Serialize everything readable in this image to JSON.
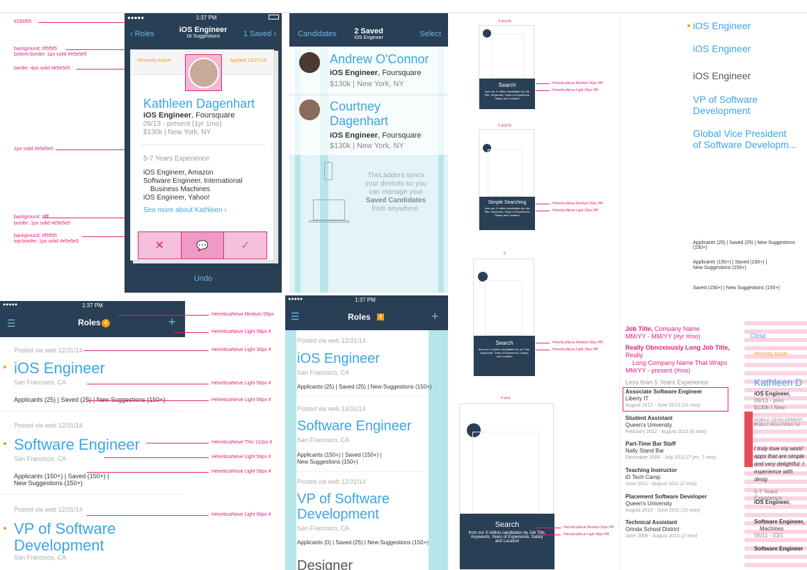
{
  "annotations_left": [
    "#283f55",
    "background: #f5f5f5",
    "bottom-border: 1px solid #e5e5e5",
    "border: 4px solid #e5e5e5",
    "1px solid #e5e5e5",
    "background: #fff",
    "border: 1px solid #e5e5e5",
    "background: #f5f5f5",
    "top-border: 1px solid #e5e5e5"
  ],
  "phone1": {
    "carrier": "●●●●●",
    "time": "1:37 PM",
    "back": "Roles",
    "title": "iOS Engineer",
    "subtitle": "16 Suggestions",
    "saved": "1 Saved",
    "recently_active": "Recently Active",
    "applied": "Applied 12/27/14",
    "name": "Kathleen Dagenhart",
    "role": "iOS Engineer",
    "company": "Foursquare",
    "dates": "09/13 - present (1yr 1mo)",
    "salary_loc": "$130k | New York, NY",
    "experience": "5-7 Years Experience",
    "jobs": [
      "iOS Engineer, Amazon",
      "Software Engineer, International",
      "Business Machines",
      "iOS Engineer, Yahoo!"
    ],
    "see_more": "See more about Kathleen ›",
    "undo": "Undo"
  },
  "phone2": {
    "back": "Candidates",
    "title": "2 Saved",
    "subtitle": "iOS Engineer",
    "select": "Select",
    "candidates": [
      {
        "name": "Andrew O'Connor",
        "role": "iOS Engineer",
        "company": "Foursquare",
        "meta": "$130k | New York, NY"
      },
      {
        "name": "Courtney Dagenhart",
        "role": "iOS Engineer",
        "company": "Foursquare",
        "meta": "$130k | New York, NY"
      }
    ],
    "sync_text_1": "TheLadders syncs",
    "sync_text_2": "your devices so you",
    "sync_text_3": "can manage your",
    "sync_bold": "Saved Candidates",
    "sync_text_4": "from anywhere."
  },
  "phone3": {
    "time": "1:37 PM",
    "title": "Roles",
    "badge": "4",
    "posted": "Posted via web 12/31/14",
    "items": [
      {
        "title": "iOS Engineer",
        "loc": "San Francisco, CA",
        "stats": "Applicants (25) | Saved (25) | New Suggestions (150+)"
      },
      {
        "title": "Software Engineer",
        "loc": "San Francisco, CA",
        "stats1": "Applicants (150+) | Saved (150+) |",
        "stats2": "New Suggestions (150+)"
      },
      {
        "title": "VP of Software",
        "title2": "Development",
        "loc": "San Francisco, CA"
      }
    ],
    "annotations": [
      "HelveticaNeue Medium 56px",
      "HelveticaNeue Light 56px #",
      "HelveticaNeue Light 36px #",
      "HelveticaNeue Light 56px #",
      "HelveticaNeue Light 56px #",
      "HelveticaNeue Thin 112px #",
      "HelveticaNeue Light 56px #",
      "HelveticaNeue Light 56px #",
      "HelveticaNeue Light 56px #"
    ]
  },
  "phone4": {
    "time": "1:37 PM",
    "title": "Roles",
    "badge": "4",
    "posted": "Posted via web 12/31/14",
    "items": [
      {
        "title": "iOS Engineer",
        "loc": "San Francisco, CA",
        "stats": "Applicants (25) | Saved (25) | New Suggestions (150+)"
      },
      {
        "title": "Software Engineer",
        "loc": "San Francisco, CA",
        "stats1": "Applicants (150+) | Saved (150+) |",
        "stats2": "New Suggestions (150+)"
      },
      {
        "title": "VP of Software",
        "title2": "Development",
        "loc": "San Francisco, CA",
        "stats": "Applicants (0) | Saved (25) | New Suggestions (150+)"
      },
      {
        "title": "Designer"
      }
    ]
  },
  "onboarding": {
    "labels": [
      "4 and 4s",
      "5 and 5s",
      "6",
      "6 plus"
    ],
    "titles": [
      "Search",
      "Simple Searching",
      "Search",
      "Search"
    ],
    "body": "from our X million candidates by Job Title, Keywords, Years of Experience, Salary and Location",
    "annotations": [
      "HelveticaNeue Medium 56px #fff",
      "HelveticaNeue Light 30px #fff",
      "HelveticaNeue Medium 56px #fff",
      "HelveticaNeue Light 30px #fff",
      "HelveticaNeue Medium 60px #fff",
      "HelveticaNeue Light 34px #fff",
      "HelveticaNeue Medium 90px #fff",
      "HelveticaNeue Light 48px #fff"
    ]
  },
  "specs": {
    "titles": [
      "iOS Engineer",
      "iOS Engineer",
      "iOS Engineer",
      "VP of Software",
      "Development",
      "Global Vice President",
      "of Software Developm..."
    ],
    "status": [
      "Applicants (25) | Saved (25) | New Suggestions (150+)",
      "Applicants (150+) | Saved (150+) |",
      "New Suggestions (150+)",
      "Saved (150+) | New Suggestions (150+)"
    ],
    "job_title": "Job Title,",
    "company_name": "Company Name",
    "dates_mm": "MM/YY - MM/YY (#yr #mo)",
    "long_title": "Really Obnoxiously Long Job Title,",
    "long_title_rest": "Really",
    "long_company": "Long Company Name That Wraps",
    "present": "MM/YY - present (#mo)",
    "less_than": "Less than 5 Years Experience",
    "history": [
      {
        "title": "Associate Software Engineer",
        "company": "Liberty IT",
        "dates": "August 2012 - June 2013",
        "dur": "(10 mos)"
      },
      {
        "title": "Student Assistant",
        "company": "Queen's University",
        "dates": "February 2012 - August 2012",
        "dur": "(6 mos)"
      },
      {
        "title": "Part-Time Bar Staff",
        "company": "Nally Stand Bar",
        "dates": "December 2004 - July 2012",
        "dur": "(7 yrs, 7 mos)"
      },
      {
        "title": "Teaching Instructor",
        "company": "iD Tech Camp",
        "dates": "June 2011 - August 2011",
        "dur": "(2 mos)"
      },
      {
        "title": "Placement Software Developer",
        "company": "Queen's University",
        "dates": "August 2010 - June 2011",
        "dur": "(10 mos)"
      },
      {
        "title": "Technical Assistant",
        "company": "Orinda School District",
        "dates": "June 2008 - August 2010",
        "dur": "(2 mos)"
      }
    ]
  },
  "phone5": {
    "close": "Close",
    "recently_active": "Recently Active",
    "name": "Kathleen D",
    "lines": [
      "iOS Engineer,",
      "09/13 - pres",
      "$130k | New"
    ],
    "skills": "MOBILE DEVELOPMENT, A",
    "skills2": "PUBLIC RELATIONS SA",
    "quote1": "I truly love my work!",
    "quote2": "apps that are simple",
    "quote3": "and very delightful. I",
    "quote4": "experience with desig",
    "exp": "5-7 Years Experience",
    "jobs": [
      "iOS Engineer,",
      "Software Engineer,",
      "Machines",
      "06/11 - 03/1",
      "Software Engineer"
    ]
  }
}
